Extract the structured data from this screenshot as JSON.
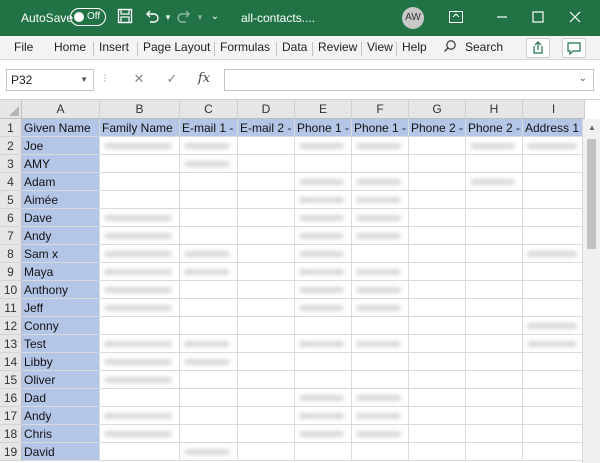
{
  "titlebar": {
    "autosave_label": "AutoSave",
    "toggle_state": "Off",
    "filename": "all-contacts....",
    "user_initials": "AW"
  },
  "ribbon": {
    "tabs": [
      "File",
      "Home",
      "Insert",
      "Page Layout",
      "Formulas",
      "Data",
      "Review",
      "View",
      "Help"
    ],
    "search_label": "Search"
  },
  "formula_bar": {
    "name_box": "P32",
    "fx": "fx",
    "formula": ""
  },
  "sheet": {
    "columns": [
      "A",
      "B",
      "C",
      "D",
      "E",
      "F",
      "G",
      "H",
      "I"
    ],
    "header_row": [
      "Given Name",
      "Family Name",
      "E-mail 1 -",
      "E-mail 2 -",
      "Phone 1 -",
      "Phone 1 -",
      "Phone 2 -",
      "Phone 2 -",
      "Address 1"
    ],
    "rows": [
      {
        "num": "1"
      },
      {
        "num": "2",
        "given": "Joe",
        "blur": [
          1,
          2,
          4,
          5,
          7,
          8
        ]
      },
      {
        "num": "3",
        "given": "AMY",
        "blur": [
          2
        ]
      },
      {
        "num": "4",
        "given": "Adam",
        "blur": [
          4,
          5,
          7
        ]
      },
      {
        "num": "5",
        "given": "Aimée",
        "blur": [
          4,
          5
        ]
      },
      {
        "num": "6",
        "given": "Dave",
        "blur": [
          1,
          4,
          5
        ]
      },
      {
        "num": "7",
        "given": "Andy",
        "blur": [
          1,
          4,
          5
        ]
      },
      {
        "num": "8",
        "given": "Sam x",
        "blur": [
          1,
          2,
          4,
          8
        ]
      },
      {
        "num": "9",
        "given": "Maya",
        "blur": [
          1,
          2,
          4,
          5
        ]
      },
      {
        "num": "10",
        "given": "Anthony",
        "blur": [
          1,
          4,
          5
        ]
      },
      {
        "num": "11",
        "given": "Jeff",
        "blur": [
          1,
          4,
          5
        ]
      },
      {
        "num": "12",
        "given": "Conny",
        "blur": [
          8
        ]
      },
      {
        "num": "13",
        "given": "Test",
        "blur": [
          1,
          2,
          4,
          5,
          8
        ]
      },
      {
        "num": "14",
        "given": "Libby",
        "blur": [
          1,
          2
        ]
      },
      {
        "num": "15",
        "given": "Oliver",
        "blur": [
          1
        ]
      },
      {
        "num": "16",
        "given": "Dad",
        "blur": [
          4,
          5
        ]
      },
      {
        "num": "17",
        "given": "Andy",
        "blur": [
          1,
          4,
          5
        ]
      },
      {
        "num": "18",
        "given": "Chris",
        "blur": [
          1,
          4,
          5
        ]
      },
      {
        "num": "19",
        "given": "David",
        "blur": [
          2
        ]
      }
    ]
  },
  "colors": {
    "excel_green": "#217346",
    "header_highlight": "#b4c6e7"
  }
}
